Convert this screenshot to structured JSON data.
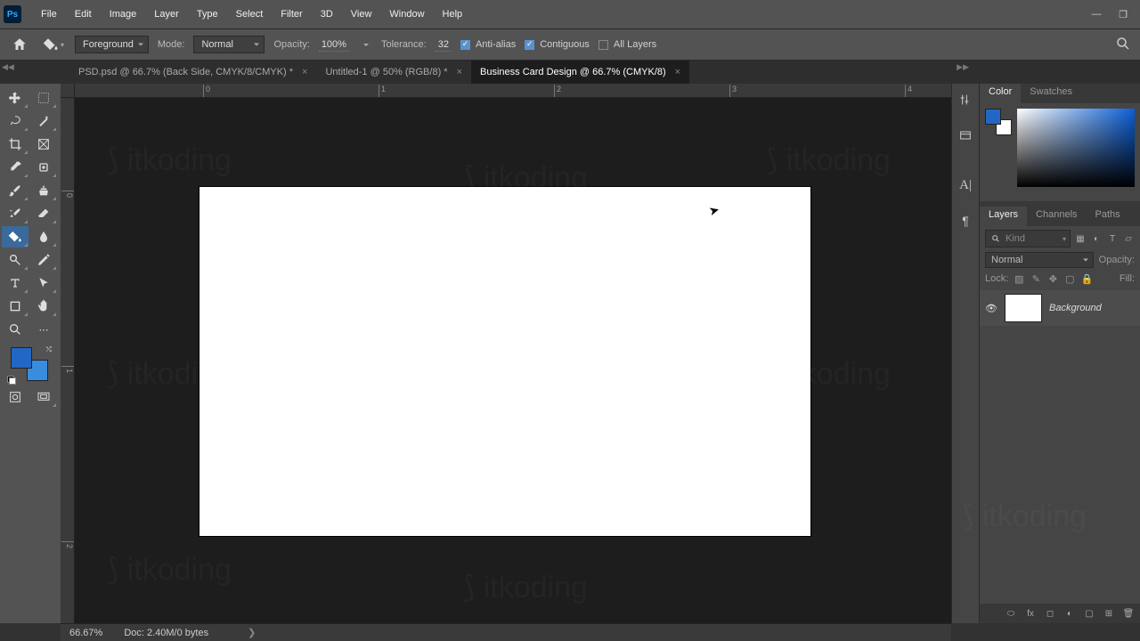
{
  "menu": {
    "items": [
      "File",
      "Edit",
      "Image",
      "Layer",
      "Type",
      "Select",
      "Filter",
      "3D",
      "View",
      "Window",
      "Help"
    ]
  },
  "options": {
    "fill_source": "Foreground",
    "mode_label": "Mode:",
    "mode_value": "Normal",
    "opacity_label": "Opacity:",
    "opacity_value": "100%",
    "tolerance_label": "Tolerance:",
    "tolerance_value": "32",
    "antialias": "Anti-alias",
    "contiguous": "Contiguous",
    "all_layers": "All Layers"
  },
  "tabs": [
    {
      "label": "PSD.psd @ 66.7% (Back Side, CMYK/8/CMYK) *",
      "active": false
    },
    {
      "label": "Untitled-1 @ 50% (RGB/8) *",
      "active": false
    },
    {
      "label": "Business Card Design @ 66.7% (CMYK/8)",
      "active": true
    }
  ],
  "ruler_h": [
    "0",
    "1",
    "2",
    "3",
    "4"
  ],
  "ruler_v": [
    "0",
    "1",
    "2"
  ],
  "panels": {
    "color_tabs": [
      "Color",
      "Swatches"
    ],
    "layer_tabs": [
      "Layers",
      "Channels",
      "Paths"
    ],
    "kind_placeholder": "Kind",
    "blend_mode": "Normal",
    "opacity_label": "Opacity:",
    "lock_label": "Lock:",
    "fill_label": "Fill:"
  },
  "layers": [
    {
      "name": "Background"
    }
  ],
  "status": {
    "zoom": "66.67%",
    "doc_info": "Doc: 2.40M/0 bytes"
  },
  "colors": {
    "foreground": "#2267c4",
    "background": "#3a8dde"
  }
}
